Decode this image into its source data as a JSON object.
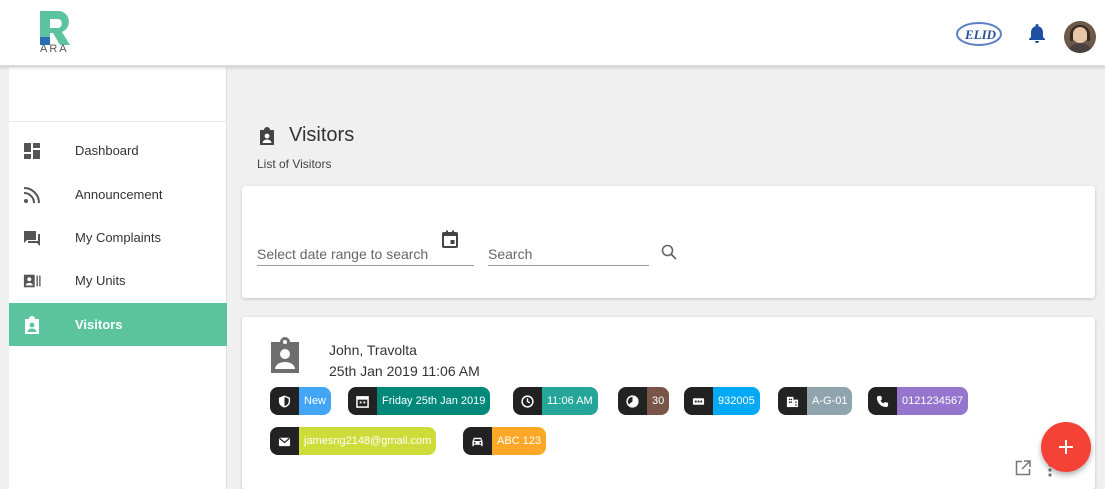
{
  "header": {
    "logo_text": "ARA",
    "partner_logo_text": "ELID"
  },
  "sidebar": {
    "items": [
      {
        "label": "Dashboard",
        "icon": "dashboard-icon"
      },
      {
        "label": "Announcement",
        "icon": "rss-feed-icon"
      },
      {
        "label": "My Complaints",
        "icon": "chat-bubbles-icon"
      },
      {
        "label": "My Units",
        "icon": "id-card-icon"
      },
      {
        "label": "Visitors",
        "icon": "visitor-badge-icon",
        "active": true
      }
    ]
  },
  "page": {
    "title": "Visitors",
    "subtitle": "List of Visitors"
  },
  "filters": {
    "date_placeholder": "Select date range to search",
    "search_placeholder": "Search"
  },
  "visitor": {
    "name": "John, Travolta",
    "datetime": "25th Jan 2019 11:06 AM",
    "chips": {
      "status": {
        "value": "New",
        "color": "#42a5f5",
        "icon": "shield-icon"
      },
      "date": {
        "value": "Friday 25th Jan 2019",
        "color": "#00897b",
        "icon": "calendar-icon"
      },
      "time": {
        "value": "11:06 AM",
        "color": "#26a69a",
        "icon": "clock-icon"
      },
      "duration": {
        "value": "30",
        "color": "#795548",
        "icon": "timer-icon"
      },
      "pin": {
        "value": "932005",
        "color": "#03a9f4",
        "icon": "pin-icon"
      },
      "unit": {
        "value": "A-G-01",
        "color": "#90a4ae",
        "icon": "building-icon"
      },
      "phone": {
        "value": "0121234567",
        "color": "#9575cd",
        "icon": "phone-icon"
      },
      "email": {
        "value": "jamesng2148@gmail.com",
        "color": "#cddc39",
        "icon": "mail-icon"
      },
      "vehicle": {
        "value": "ABC 123",
        "color": "#ffa726",
        "icon": "car-icon"
      }
    }
  },
  "colors": {
    "accent": "#5bc49f",
    "fab": "#f44336"
  }
}
